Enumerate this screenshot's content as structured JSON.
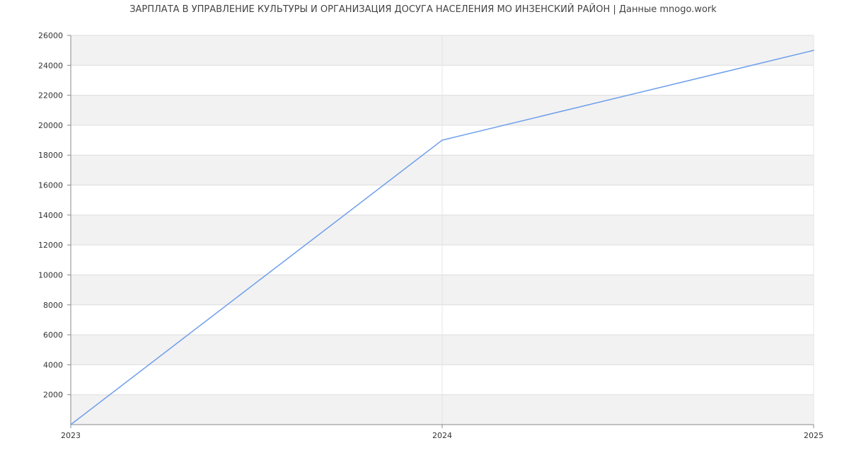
{
  "chart_data": {
    "type": "line",
    "title": "ЗАРПЛАТА В УПРАВЛЕНИЕ КУЛЬТУРЫ И ОРГАНИЗАЦИЯ ДОСУГА НАСЕЛЕНИЯ МО ИНЗЕНСКИЙ РАЙОН | Данные mnogo.work",
    "xlabel": "",
    "ylabel": "",
    "categories": [
      "2023",
      "2024",
      "2025"
    ],
    "series": [
      {
        "values": [
          0,
          19000,
          25000
        ]
      }
    ],
    "ylim": [
      0,
      26000
    ],
    "yticks": [
      2000,
      4000,
      6000,
      8000,
      10000,
      12000,
      14000,
      16000,
      18000,
      20000,
      22000,
      24000,
      26000
    ],
    "grid": true,
    "legend": "none",
    "colors": {
      "line": "#6d9eeb",
      "band": "#f2f2f2",
      "grid": "#dddddd",
      "axis": "#888888"
    }
  }
}
